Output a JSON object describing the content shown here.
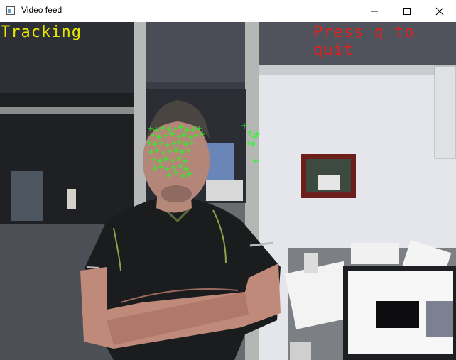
{
  "window": {
    "title": "Video feed",
    "icon": "opencv-window-icon",
    "controls": [
      "minimize-icon",
      "maximize-icon",
      "close-icon"
    ]
  },
  "overlay": {
    "status": "Tracking",
    "status_color": "#e6e600",
    "quit_hint": "Press q to quit",
    "quit_color": "#e02020"
  },
  "colors": {
    "marker_color": "#1aff1a"
  }
}
